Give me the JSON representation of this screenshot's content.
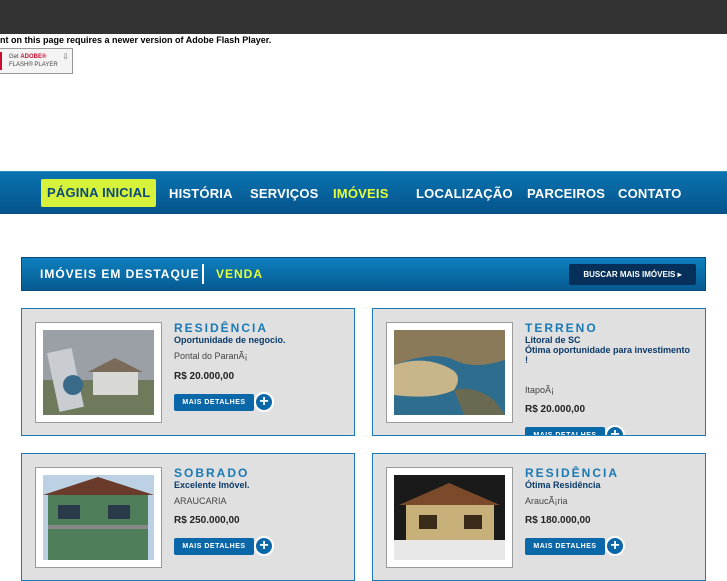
{
  "flash": {
    "message": "ent on this page requires a newer version of Adobe Flash Player.",
    "badge_line1_prefix": "Get ",
    "badge_line1_brand": "ADOBE®",
    "badge_line2": "FLASH® PLAYER"
  },
  "nav": {
    "items": [
      {
        "label": "PÁGINA INICIAL"
      },
      {
        "label": "HISTÓRIA"
      },
      {
        "label": "SERVIÇOS"
      },
      {
        "label": "IMÓVEIS"
      },
      {
        "label": "LOCALIZAÇÃO"
      },
      {
        "label": "PARCEIROS"
      },
      {
        "label": "CONTATO"
      }
    ]
  },
  "featured": {
    "label": "IMÓVEIS EM DESTAQUE",
    "sub": "VENDA",
    "button": "BUSCAR MAIS IMÓVEIS ▸"
  },
  "listings": [
    {
      "type": "RESIDÊNCIA",
      "title": "Oportunidade de negocio.",
      "location": "Pontal do ParanÃ¡",
      "price": "R$ 20.000,00",
      "more": "MAIS DETALHES"
    },
    {
      "type": "TERRENO",
      "title": "Litoral de SC\nÓtima oportunidade para investimento !",
      "location": "ItapoÃ¡",
      "price": "R$ 20.000,00",
      "more": "MAIS DETALHES"
    },
    {
      "type": "SOBRADO",
      "title": "Excelente Imóvel.",
      "location": "ARAUCARIA",
      "price": "R$ 250.000,00",
      "more": "MAIS DETALHES"
    },
    {
      "type": "RESIDÊNCIA",
      "title": "Ótima Residência",
      "location": "AraucÃ¡ria",
      "price": "R$ 180.000,00",
      "more": "MAIS DETALHES"
    }
  ],
  "colors": {
    "accent": "#0a68a8",
    "nav_highlight": "#e5ff3a",
    "topbar": "#333333"
  }
}
